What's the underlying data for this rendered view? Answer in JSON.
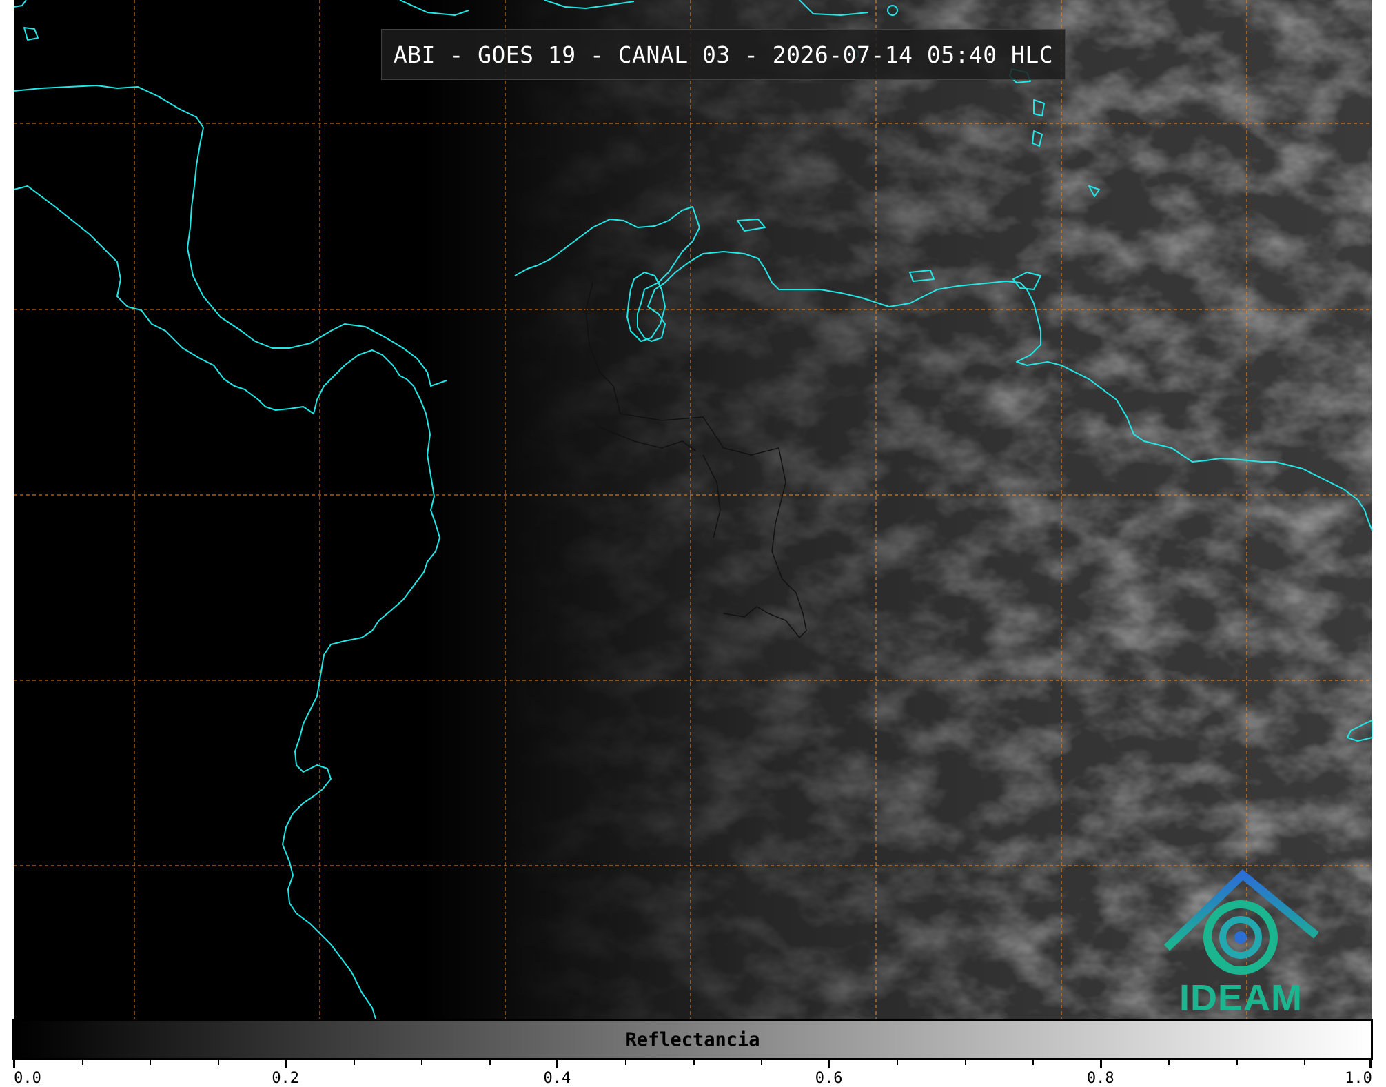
{
  "map": {
    "title": "ABI - GOES 19 - CANAL 03 - 2026-07-14 05:40 HLC",
    "coastline_color": "#22e6e6",
    "grid_color": "#ff8c1a",
    "border_color": "#111111"
  },
  "logo": {
    "text": "IDEAM",
    "color": "#1bb58f"
  },
  "colorbar": {
    "label": "Reflectancia",
    "min": 0.0,
    "max": 1.0,
    "colormap": "gray",
    "major_ticks": [
      "0.0",
      "0.2",
      "0.4",
      "0.6",
      "0.8",
      "1.0"
    ],
    "minor_tick_step": 0.05
  }
}
